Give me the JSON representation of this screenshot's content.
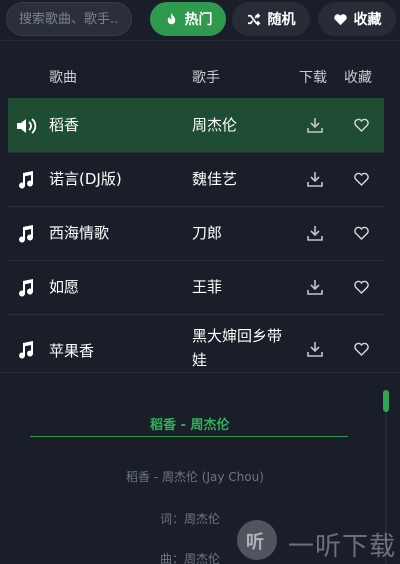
{
  "search": {
    "placeholder": "搜索歌曲、歌手..."
  },
  "tabs": {
    "hot": "热门",
    "random": "随机",
    "favorites": "收藏"
  },
  "columns": {
    "title": "歌曲",
    "artist": "歌手",
    "download": "下载",
    "favorite": "收藏"
  },
  "songs": [
    {
      "title": "稻香",
      "artist": "周杰伦",
      "playing": true
    },
    {
      "title": "诺言(DJ版)",
      "artist": "魏佳艺",
      "playing": false
    },
    {
      "title": "西海情歌",
      "artist": "刀郎",
      "playing": false
    },
    {
      "title": "如愿",
      "artist": "王菲",
      "playing": false
    },
    {
      "title": "苹果香",
      "artist": "黑大婶回乡带娃",
      "playing": false
    }
  ],
  "lyrics": {
    "heading": "稻香 - 周杰伦",
    "lines": [
      "稻香 - 周杰伦 (Jay Chou)",
      "词：周杰伦",
      "曲：周杰伦"
    ]
  },
  "watermark": {
    "logo": "听",
    "text": "一听下载"
  },
  "colors": {
    "accent": "#2f9a4e",
    "active_row": "#1f4d33",
    "background": "#1a1e28"
  }
}
